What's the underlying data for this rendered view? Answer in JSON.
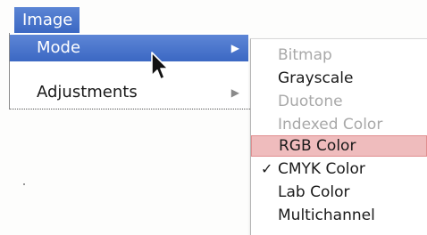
{
  "menubar": {
    "title": "Image"
  },
  "menu": {
    "items": [
      {
        "label": "Mode",
        "submenu_arrow": "▶"
      },
      {
        "label": "Adjustments",
        "submenu_arrow": "▶"
      }
    ]
  },
  "submenu": {
    "items": [
      {
        "label": "Bitmap",
        "enabled": false,
        "checked": false
      },
      {
        "label": "Grayscale",
        "enabled": true,
        "checked": false
      },
      {
        "label": "Duotone",
        "enabled": false,
        "checked": false
      },
      {
        "label": "Indexed Color",
        "enabled": false,
        "checked": false
      },
      {
        "label": "RGB Color",
        "enabled": true,
        "checked": false,
        "hovered": true
      },
      {
        "label": "CMYK Color",
        "enabled": true,
        "checked": true,
        "check_mark": "✓"
      },
      {
        "label": "Lab Color",
        "enabled": true,
        "checked": false
      },
      {
        "label": "Multichannel",
        "enabled": true,
        "checked": false
      }
    ]
  },
  "colors": {
    "highlight": "#3b68c3",
    "hover_row": "#efbcbd",
    "disabled_text": "#a8a8a8"
  },
  "icons": {
    "cursor": "arrow-pointer-icon",
    "submenu_arrow": "triangle-right-icon",
    "check": "checkmark-icon"
  }
}
